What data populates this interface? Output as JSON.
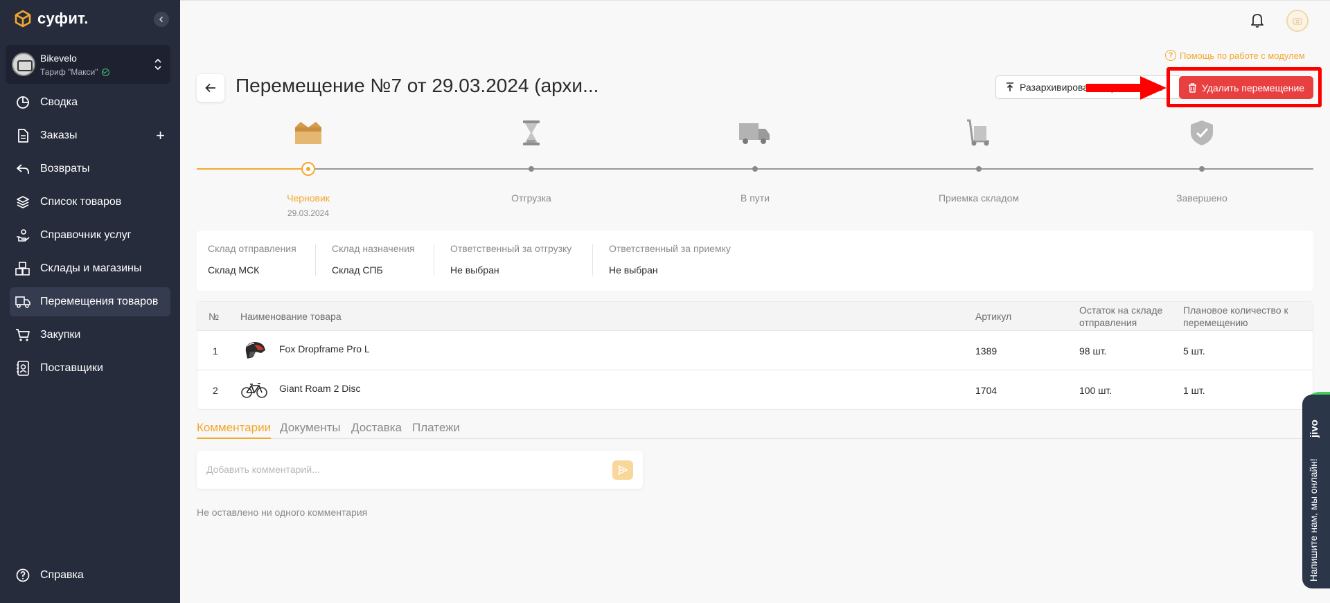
{
  "sidebar": {
    "logo_text": "суфит.",
    "account": {
      "name": "Bikevelo",
      "plan": "Тариф \"Макси\""
    },
    "items": [
      {
        "label": "Сводка",
        "icon": "pie-chart-icon"
      },
      {
        "label": "Заказы",
        "icon": "document-icon"
      },
      {
        "label": "Возвраты",
        "icon": "return-icon"
      },
      {
        "label": "Список товаров",
        "icon": "layers-icon"
      },
      {
        "label": "Справочник услуг",
        "icon": "hand-service-icon"
      },
      {
        "label": "Склады и магазины",
        "icon": "boxes-icon"
      },
      {
        "label": "Перемещения товаров",
        "icon": "truck-icon"
      },
      {
        "label": "Закупки",
        "icon": "cart-icon"
      },
      {
        "label": "Поставщики",
        "icon": "contact-book-icon"
      }
    ],
    "help": "Справка"
  },
  "header": {
    "help_module": "Помощь по работе с модулем",
    "title": "Перемещение №7 от 29.03.2024 (архи...",
    "unarchive_label": "Разархивировать перемещение",
    "delete_label": "Удалить перемещение"
  },
  "stepper": {
    "steps": [
      {
        "label": "Черновик",
        "date": "29.03.2024",
        "active": true
      },
      {
        "label": "Отгрузка"
      },
      {
        "label": "В пути"
      },
      {
        "label": "Приемка складом"
      },
      {
        "label": "Завершено"
      }
    ]
  },
  "info": [
    {
      "label": "Склад отправления",
      "value": "Склад МСК"
    },
    {
      "label": "Склад назначения",
      "value": "Склад СПБ"
    },
    {
      "label": "Ответственный за отгрузку",
      "value": "Не выбран"
    },
    {
      "label": "Ответственный за приемку",
      "value": "Не выбран"
    }
  ],
  "table": {
    "headers": {
      "num": "№",
      "name": "Наименование товара",
      "sku": "Артикул",
      "stock_line1": "Остаток на складе",
      "stock_line2": "отправления",
      "qty_line1": "Плановое количество к",
      "qty_line2": "перемещению"
    },
    "rows": [
      {
        "num": "1",
        "name": "Fox Dropframe Pro L",
        "sku": "1389",
        "stock": "98 шт.",
        "qty": "5 шт.",
        "image": "helmet"
      },
      {
        "num": "2",
        "name": "Giant Roam 2 Disc",
        "sku": "1704",
        "stock": "100 шт.",
        "qty": "1 шт.",
        "image": "bicycle"
      }
    ]
  },
  "tabs": [
    "Комментарии",
    "Документы",
    "Доставка",
    "Платежи"
  ],
  "comments": {
    "placeholder": "Добавить комментарий...",
    "empty_text": "Не оставлено ни одного комментария"
  },
  "jivo": {
    "brand": "jivo",
    "text": "Напишите нам, мы онлайн!"
  },
  "colors": {
    "accent": "#f2a82c",
    "danger": "#e84040",
    "sidebar": "#272c3c",
    "annotation": "#ff0000"
  }
}
